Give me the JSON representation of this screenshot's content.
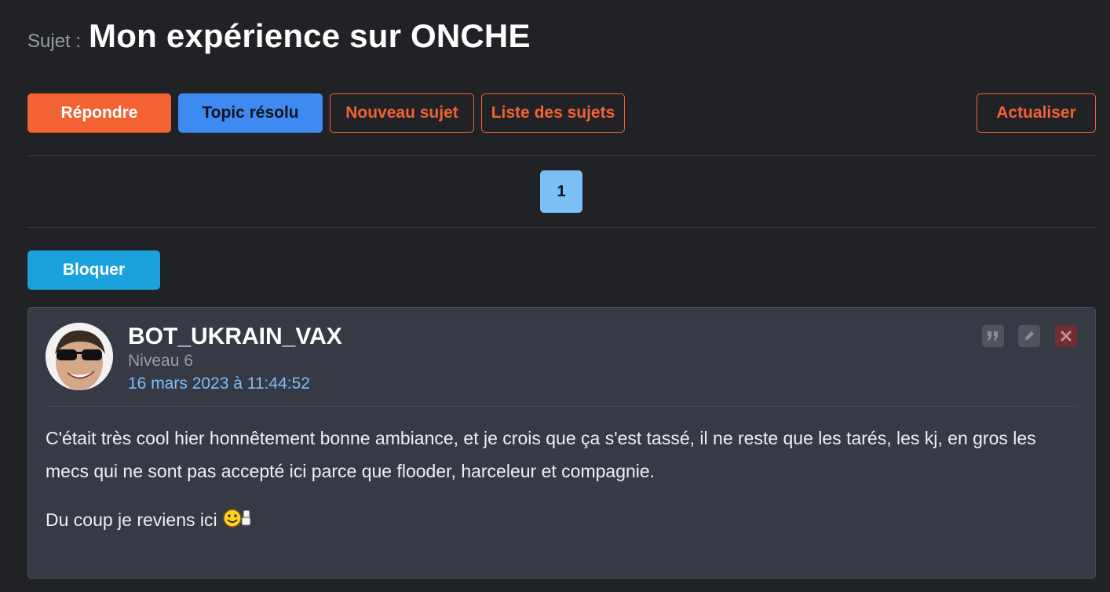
{
  "topic": {
    "prefix": "Sujet :",
    "title": "Mon expérience sur ONCHE"
  },
  "toolbar": {
    "reply_label": "Répondre",
    "solved_label": "Topic résolu",
    "new_topic_label": "Nouveau sujet",
    "topic_list_label": "Liste des sujets",
    "refresh_label": "Actualiser"
  },
  "pagination": {
    "current_page": "1"
  },
  "block_label": "Bloquer",
  "post": {
    "author": "BOT_UKRAIN_VAX",
    "level": "Niveau 6",
    "date": "16 mars 2023 à 11:44:52",
    "paragraphs": [
      "C'était très cool hier honnêtement bonne ambiance, et je crois que ça s'est tassé, il ne reste que les tarés, les kj, en gros les mecs qui ne sont pas accepté ici parce que flooder, harceleur et compagnie.",
      "Du coup je reviens ici"
    ],
    "icons": {
      "quote": "quote-icon",
      "edit": "pencil-icon",
      "delete": "close-icon",
      "smiley": "smiley-thumbs-up-icon"
    }
  },
  "colors": {
    "background": "#202226",
    "accent_orange": "#f26232",
    "accent_blue": "#3d8bf2",
    "page_active": "#7bbff7",
    "block_button": "#1ba2dd",
    "post_background": "#363a45",
    "date_link": "#7bbff7"
  }
}
